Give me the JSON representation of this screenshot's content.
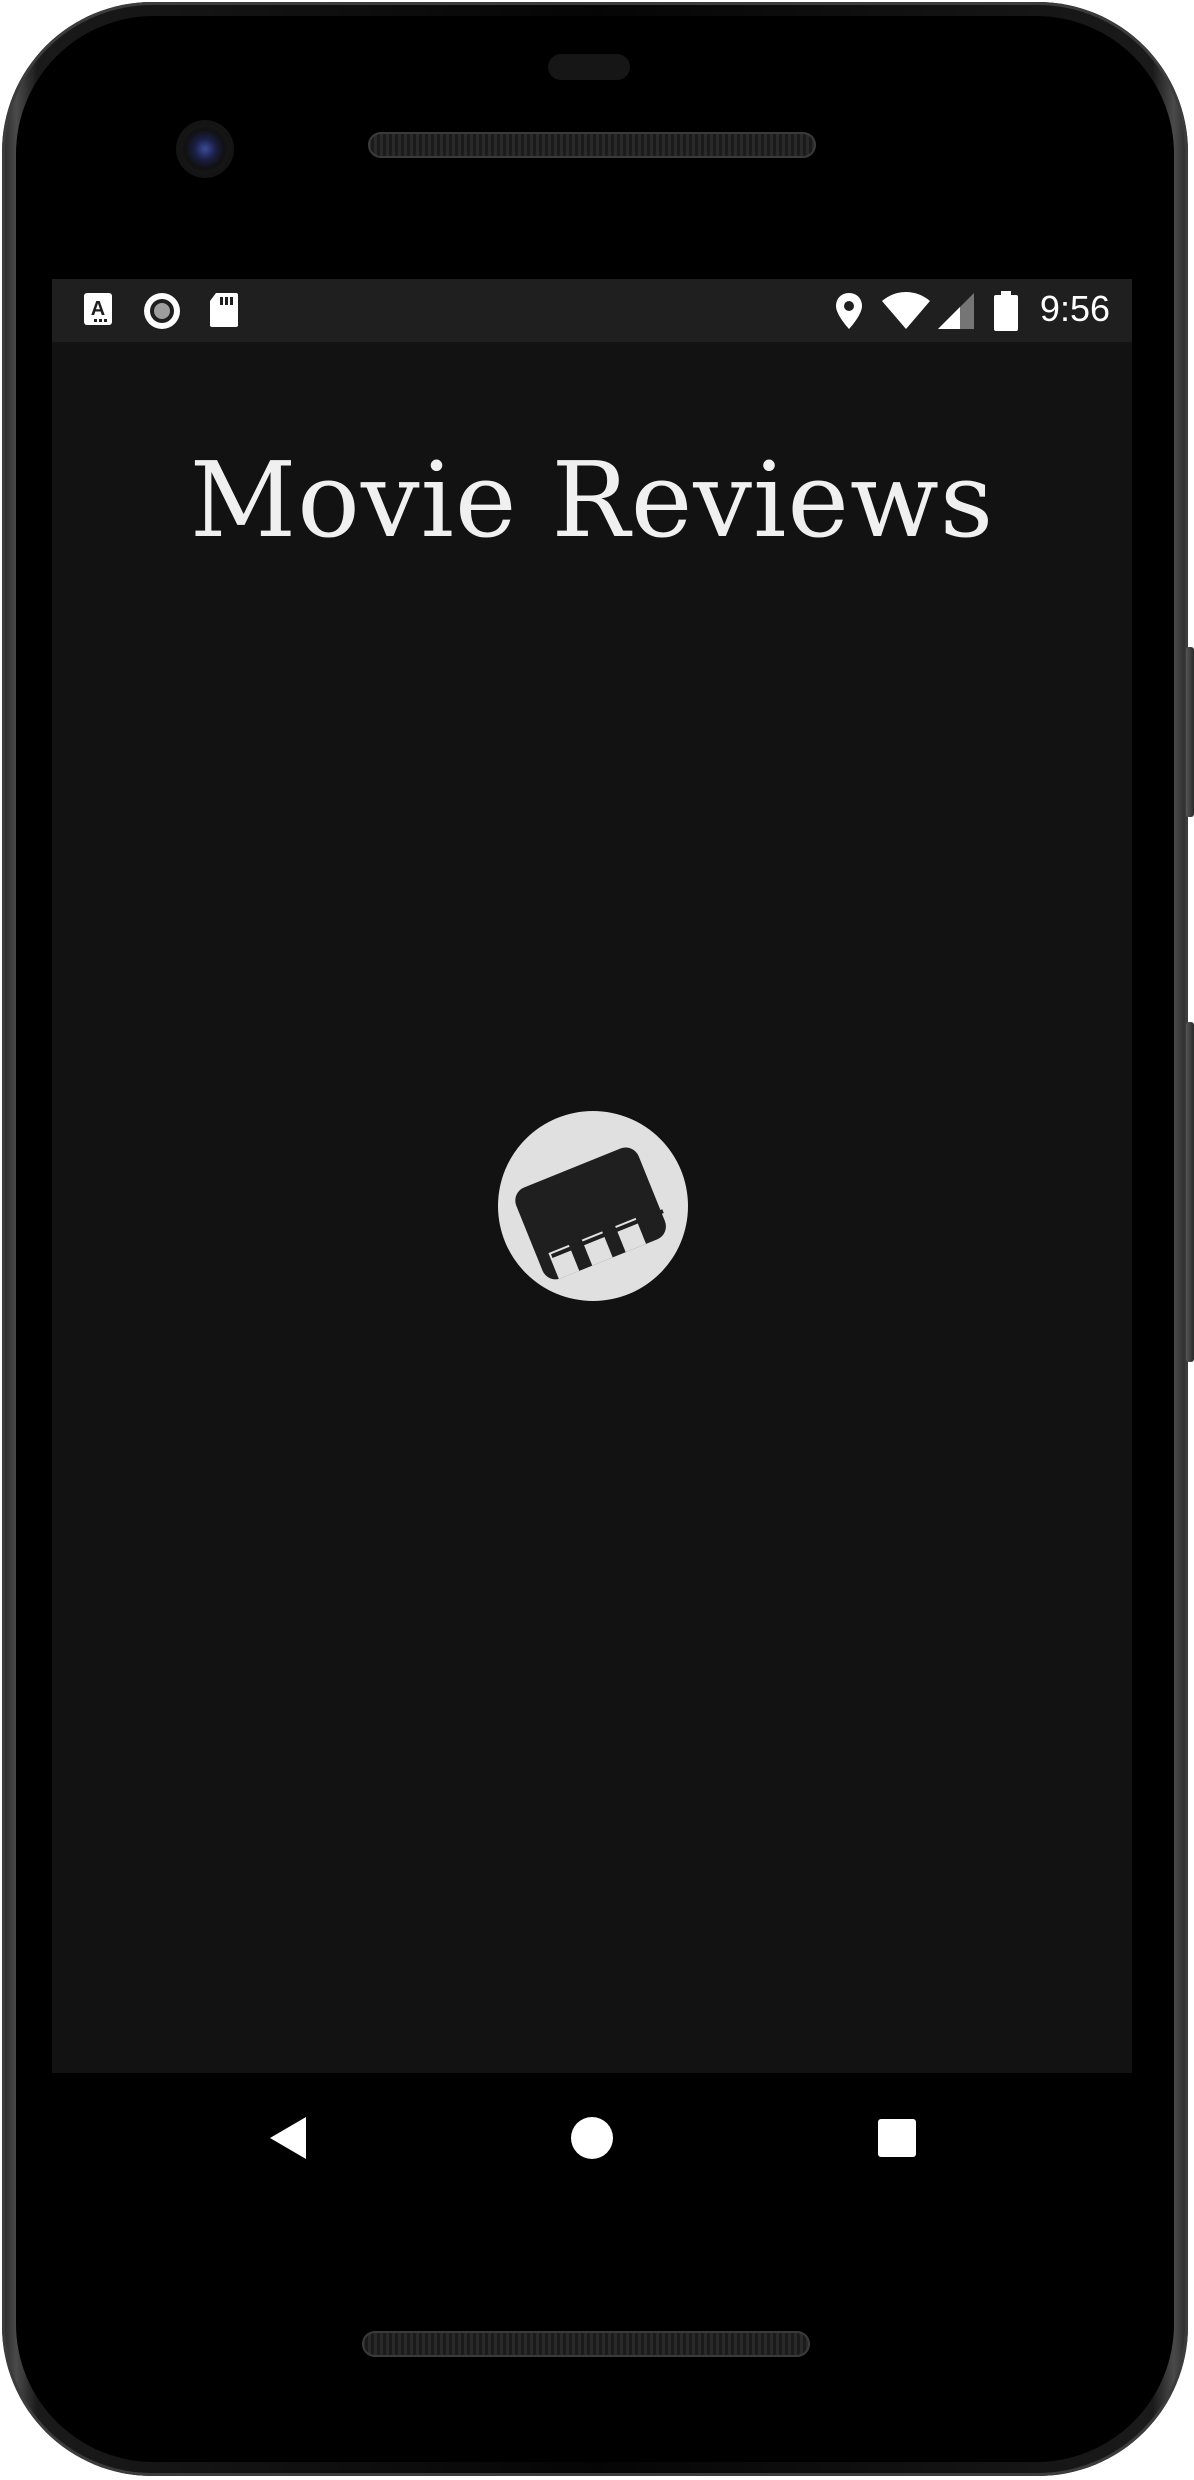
{
  "status_bar": {
    "time": "9:56",
    "left_icons": [
      "accessibility-a-icon",
      "record-circle-icon",
      "sd-card-icon"
    ],
    "right_icons": [
      "location-icon",
      "wifi-icon",
      "signal-icon",
      "battery-icon"
    ]
  },
  "app": {
    "title": "Movie Reviews",
    "logo_icon": "clapperboard-logo-icon"
  },
  "nav_bar": {
    "buttons": [
      "back-icon",
      "home-icon",
      "recents-icon"
    ]
  },
  "colors": {
    "screen_background": "#121212",
    "status_bar_background": "#1f1f1f",
    "title_color": "#f0f0f0",
    "logo_circle": "#e0e0e0",
    "logo_board": "#1f1f1f"
  }
}
